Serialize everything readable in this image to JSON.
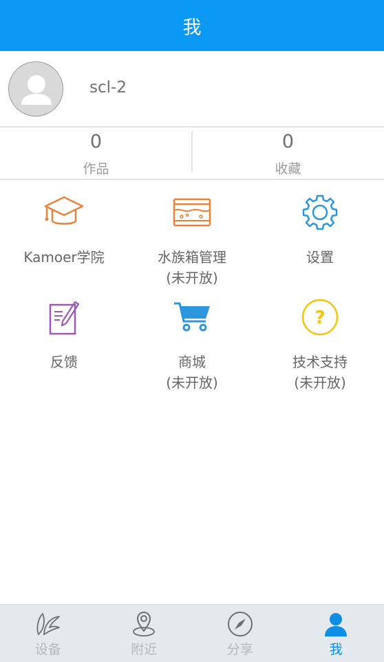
{
  "header": {
    "title": "我",
    "background": "#0999f5"
  },
  "profile": {
    "username": "scl-2"
  },
  "stats": [
    {
      "value": "0",
      "label": "作品"
    },
    {
      "value": "0",
      "label": "收藏"
    }
  ],
  "grid": [
    {
      "label": "Kamoer学院",
      "sub": "",
      "icon": "graduation-cap-icon",
      "color": "#e8823a"
    },
    {
      "label": "水族箱管理",
      "sub": "(未开放)",
      "icon": "aquarium-icon",
      "color": "#e8823a"
    },
    {
      "label": "设置",
      "sub": "",
      "icon": "gear-icon",
      "color": "#2c97de"
    },
    {
      "label": "反馈",
      "sub": "",
      "icon": "edit-note-icon",
      "color": "#9b59b6"
    },
    {
      "label": "商城",
      "sub": "(未开放)",
      "icon": "shopping-cart-icon",
      "color": "#2c97de"
    },
    {
      "label": "技术支持",
      "sub": "(未开放)",
      "icon": "help-circle-icon",
      "color": "#f1c40f"
    }
  ],
  "nav": [
    {
      "label": "设备",
      "icon": "leaf-device-icon",
      "active": false
    },
    {
      "label": "附近",
      "icon": "map-pin-icon",
      "active": false
    },
    {
      "label": "分享",
      "icon": "compass-icon",
      "active": false
    },
    {
      "label": "我",
      "icon": "user-icon",
      "active": true
    }
  ],
  "colors": {
    "accent": "#0f8ee6",
    "nav_inactive": "#b3b9bc"
  }
}
